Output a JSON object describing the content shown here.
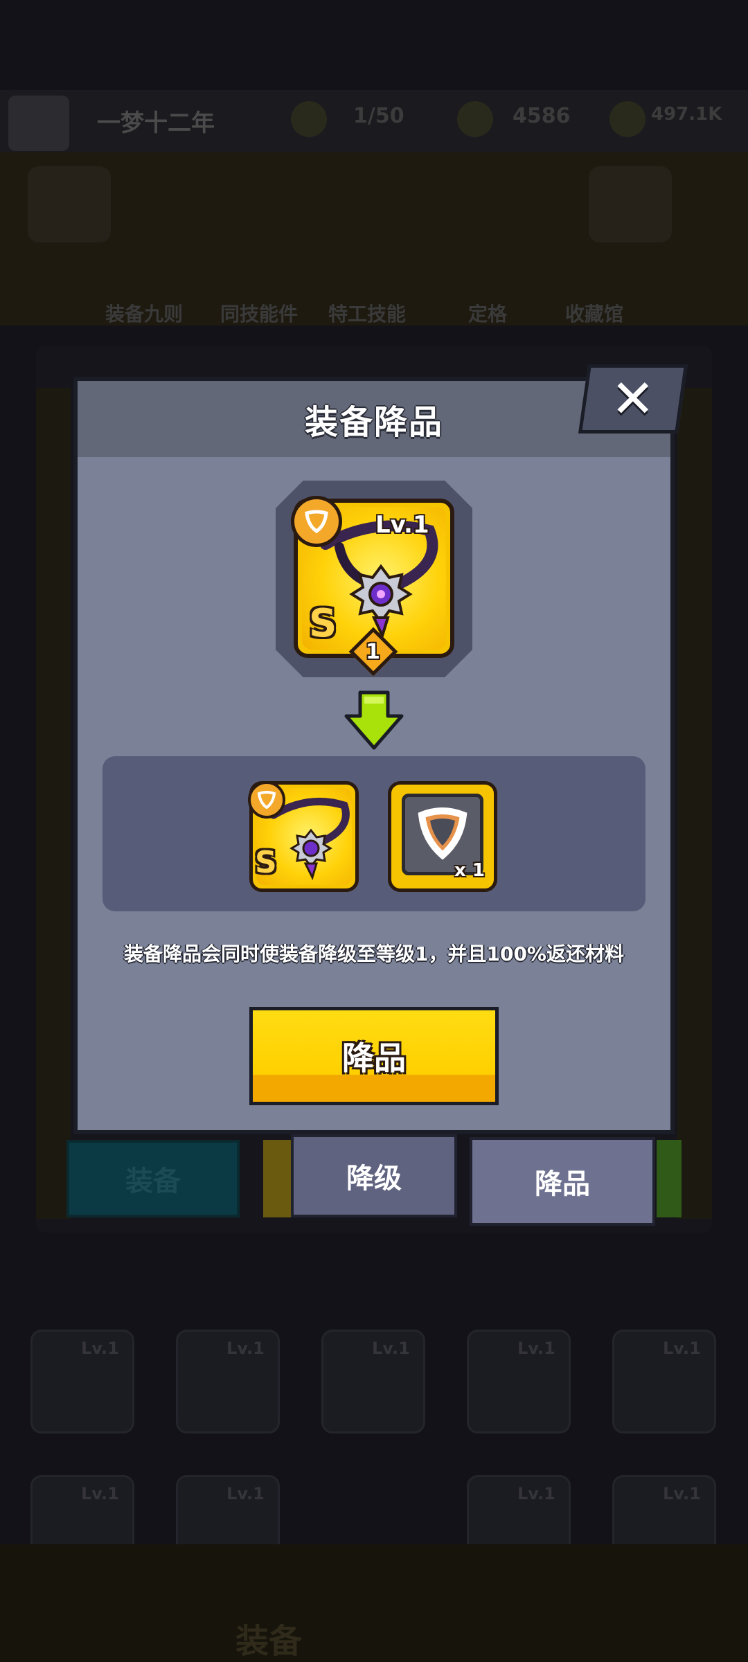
{
  "background": {
    "player_name": "一梦十二年",
    "stats": [
      "1/50",
      "4586",
      "497.1K"
    ],
    "menu_items": [
      "装备九则",
      "同技能件",
      "特工技能",
      "定格",
      "收藏馆"
    ],
    "tile_level": "Lv.1",
    "bottom_nav_label": "装备"
  },
  "tabs": {
    "equip": "装备",
    "downlevel": "降级",
    "downgrade": "降品"
  },
  "dialog": {
    "title": "装备降品",
    "close_symbol": "✕",
    "source_item": {
      "level_label": "Lv.1",
      "rank": "S",
      "star_count": "1",
      "type_icon": "necklace-icon"
    },
    "arrow_icon": "down-arrow-icon",
    "results": {
      "equipment": {
        "rank": "S",
        "type_icon": "necklace-icon"
      },
      "material": {
        "icon": "necklace-material-icon",
        "quantity": "x 1"
      }
    },
    "description": "装备降品会同时使装备降级至等级1，并且100%返还材料",
    "confirm_label": "降品"
  },
  "colors": {
    "dialog_bg": "#7b8298",
    "header_bg": "#636878",
    "result_panel_bg": "#575c78",
    "button_yellow": "#ffd000",
    "card_gold": "#f6c400",
    "arrow_green": "#a8e20a"
  }
}
